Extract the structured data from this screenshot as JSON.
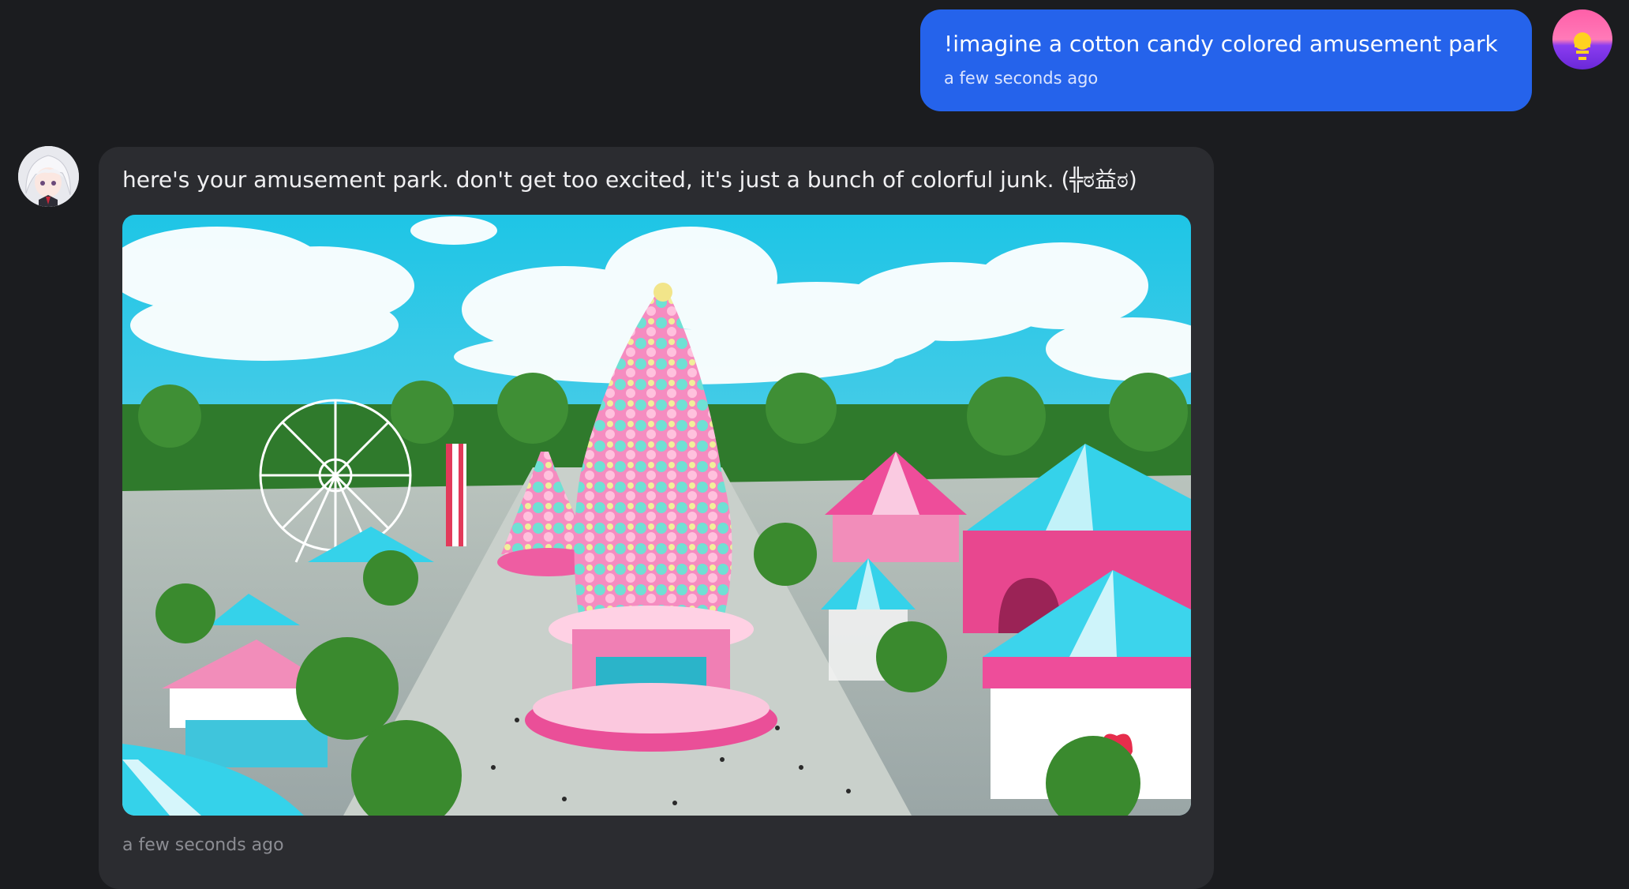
{
  "user_message": {
    "text": "!imagine a cotton candy colored amusement park",
    "time": "a few seconds ago"
  },
  "bot_message": {
    "text": "here's your amusement park. don't get too excited, it's just a bunch of colorful junk. (╬ಠ益ಠ)",
    "time": "a few seconds ago"
  },
  "colors": {
    "user_bubble": "#2563eb",
    "background": "#1b1c1f",
    "bot_card": "#2b2c30"
  }
}
